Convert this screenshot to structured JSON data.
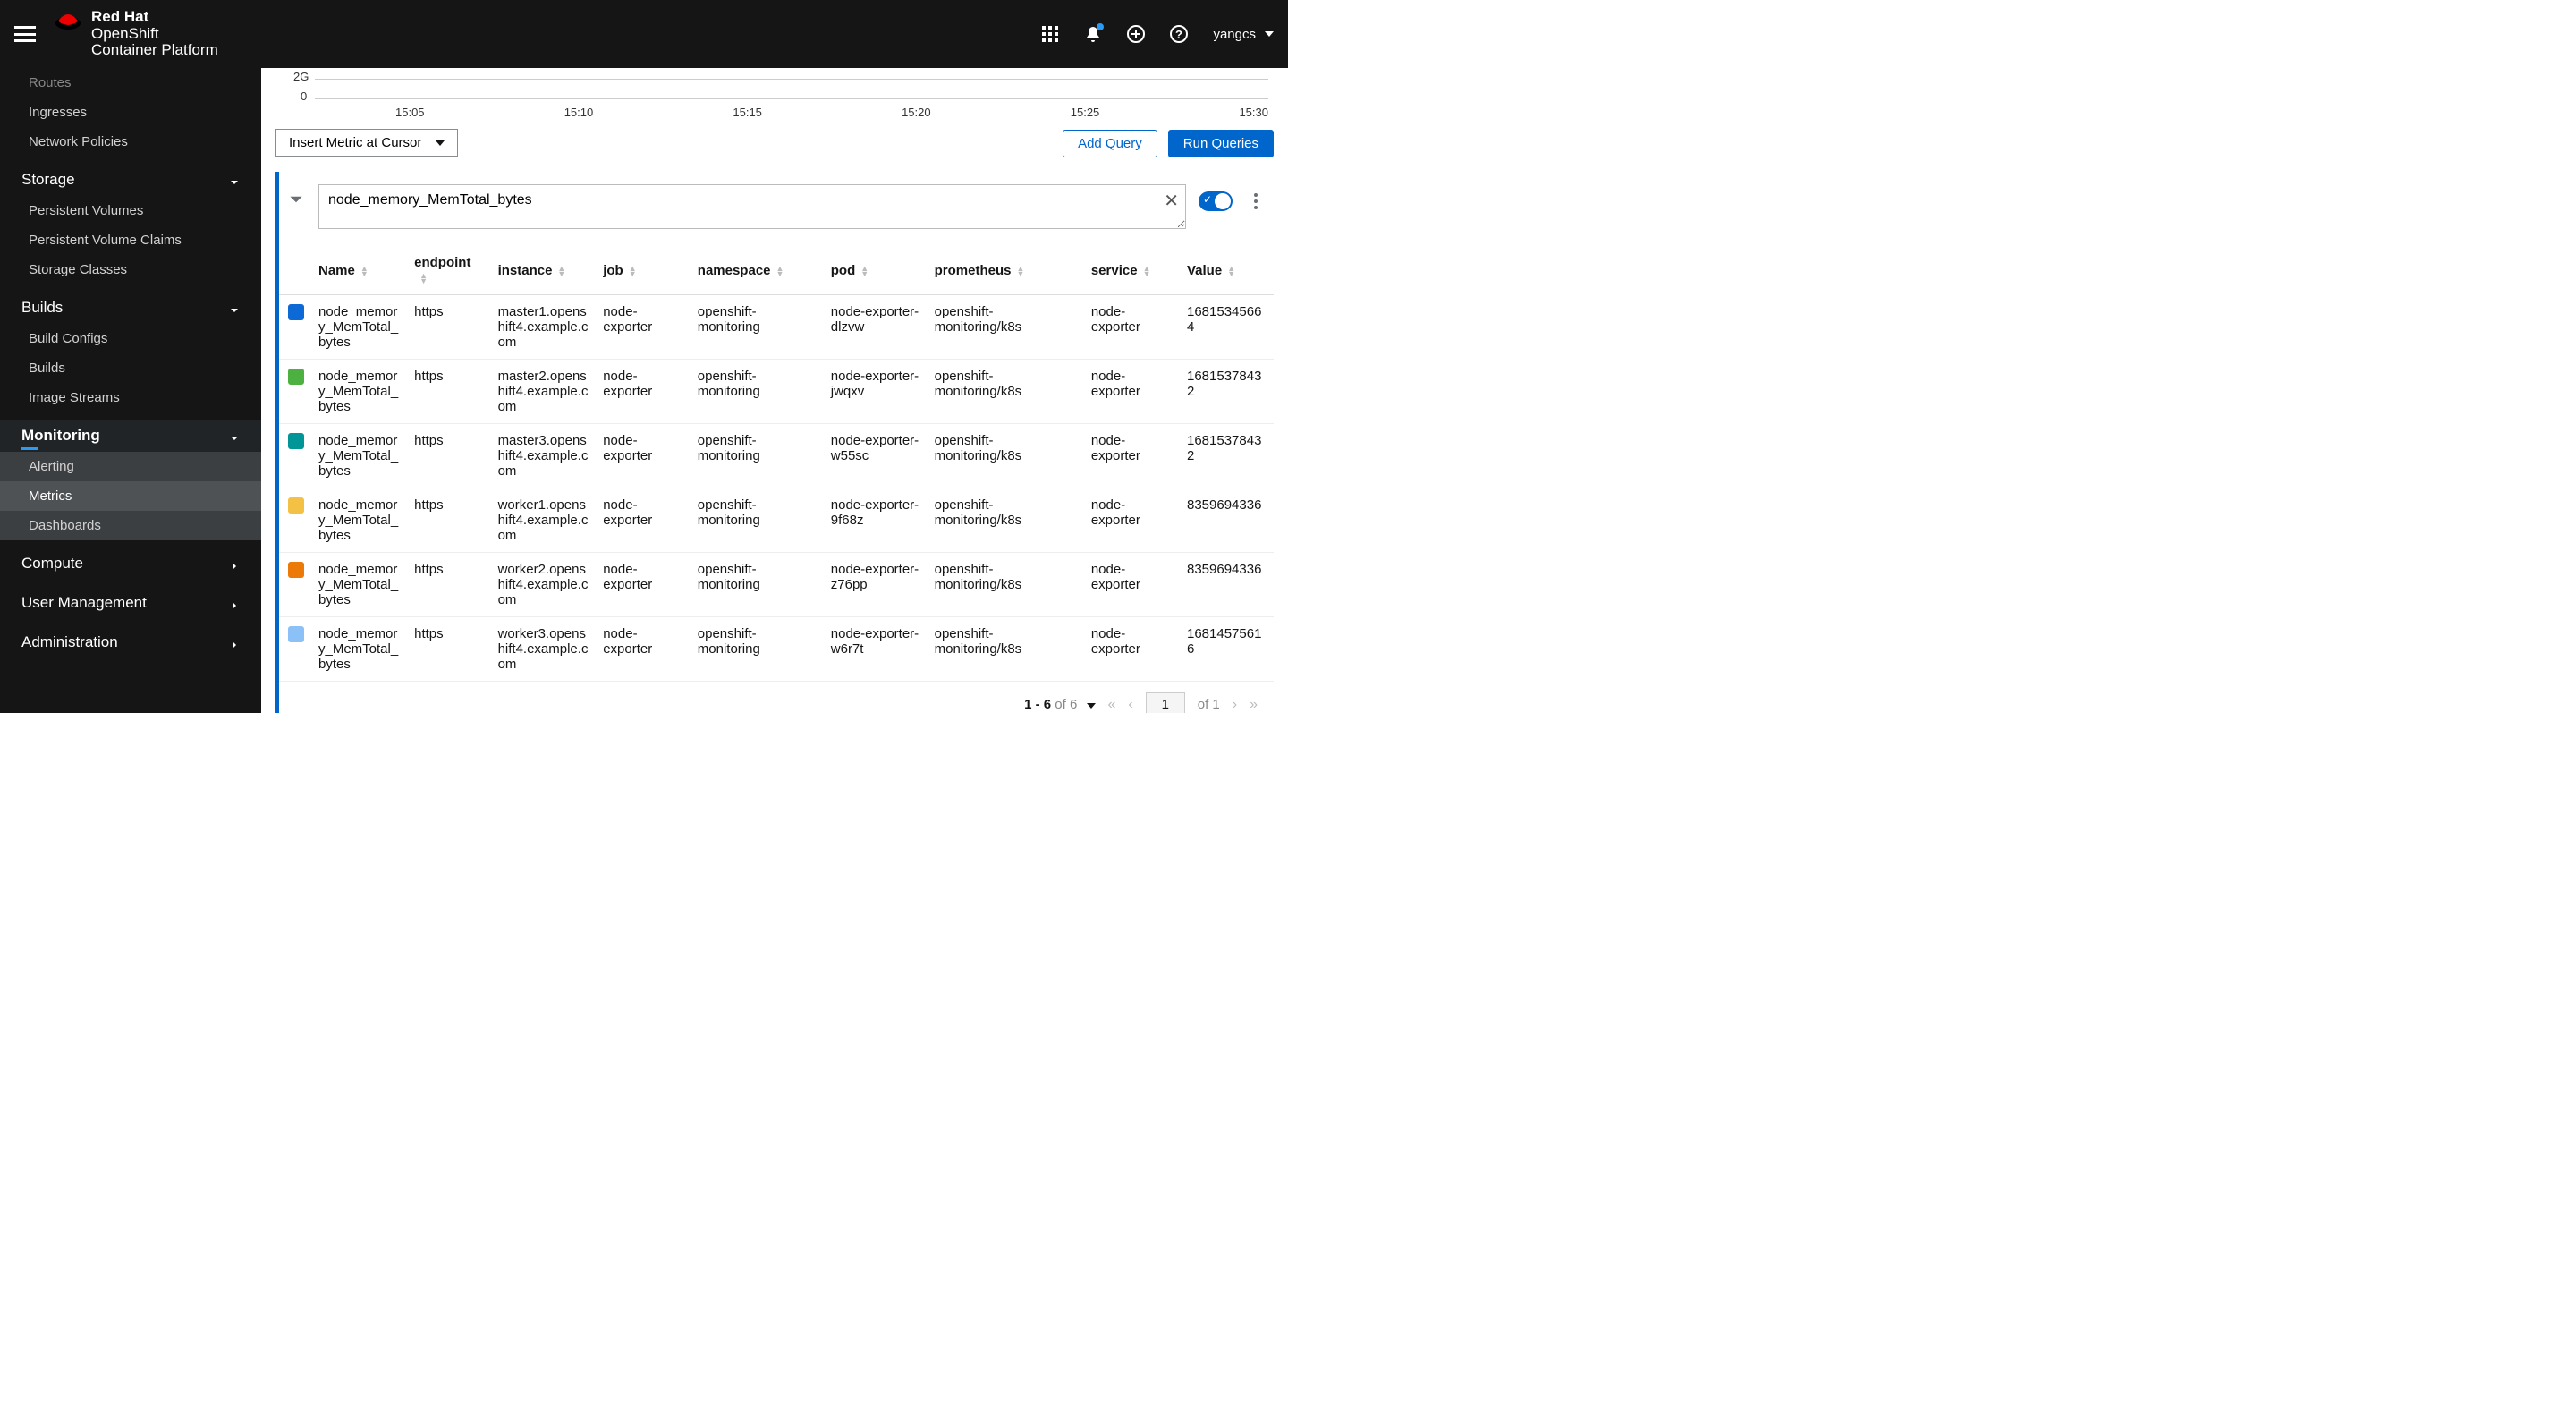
{
  "header": {
    "product_l1": "Red Hat",
    "product_l2": "OpenShift",
    "product_l3": "Container Platform",
    "username": "yangcs"
  },
  "sidebar": {
    "items_top": [
      "Routes",
      "Ingresses",
      "Network Policies"
    ],
    "storage": {
      "label": "Storage",
      "items": [
        "Persistent Volumes",
        "Persistent Volume Claims",
        "Storage Classes"
      ]
    },
    "builds": {
      "label": "Builds",
      "items": [
        "Build Configs",
        "Builds",
        "Image Streams"
      ]
    },
    "monitoring": {
      "label": "Monitoring",
      "items": [
        "Alerting",
        "Metrics",
        "Dashboards"
      ],
      "active": "Metrics"
    },
    "compute": {
      "label": "Compute"
    },
    "usermgmt": {
      "label": "User Management"
    },
    "admin": {
      "label": "Administration"
    }
  },
  "chart_data": {
    "type": "line",
    "ylabels": [
      "2G",
      "0"
    ],
    "xticks": [
      "15:05",
      "15:10",
      "15:15",
      "15:20",
      "15:25",
      "15:30"
    ]
  },
  "toolbar": {
    "dropdown_label": "Insert Metric at Cursor",
    "add_query": "Add Query",
    "run_queries": "Run Queries"
  },
  "query": {
    "value": "node_memory_MemTotal_bytes"
  },
  "table": {
    "headers": [
      "Name",
      "endpoint",
      "instance",
      "job",
      "namespace",
      "pod",
      "prometheus",
      "service",
      "Value"
    ],
    "rows": [
      {
        "color": "#0d69d6",
        "name": "node_memory_MemTotal_bytes",
        "endpoint": "https",
        "instance": "master1.openshift4.example.com",
        "job": "node-exporter",
        "namespace": "openshift-monitoring",
        "pod": "node-exporter-dlzvw",
        "prometheus": "openshift-monitoring/k8s",
        "service": "node-exporter",
        "value": "16815345664"
      },
      {
        "color": "#4cb140",
        "name": "node_memory_MemTotal_bytes",
        "endpoint": "https",
        "instance": "master2.openshift4.example.com",
        "job": "node-exporter",
        "namespace": "openshift-monitoring",
        "pod": "node-exporter-jwqxv",
        "prometheus": "openshift-monitoring/k8s",
        "service": "node-exporter",
        "value": "16815378432"
      },
      {
        "color": "#009596",
        "name": "node_memory_MemTotal_bytes",
        "endpoint": "https",
        "instance": "master3.openshift4.example.com",
        "job": "node-exporter",
        "namespace": "openshift-monitoring",
        "pod": "node-exporter-w55sc",
        "prometheus": "openshift-monitoring/k8s",
        "service": "node-exporter",
        "value": "16815378432"
      },
      {
        "color": "#f4c145",
        "name": "node_memory_MemTotal_bytes",
        "endpoint": "https",
        "instance": "worker1.openshift4.example.com",
        "job": "node-exporter",
        "namespace": "openshift-monitoring",
        "pod": "node-exporter-9f68z",
        "prometheus": "openshift-monitoring/k8s",
        "service": "node-exporter",
        "value": "8359694336"
      },
      {
        "color": "#ec7a08",
        "name": "node_memory_MemTotal_bytes",
        "endpoint": "https",
        "instance": "worker2.openshift4.example.com",
        "job": "node-exporter",
        "namespace": "openshift-monitoring",
        "pod": "node-exporter-z76pp",
        "prometheus": "openshift-monitoring/k8s",
        "service": "node-exporter",
        "value": "8359694336"
      },
      {
        "color": "#8bc1f7",
        "name": "node_memory_MemTotal_bytes",
        "endpoint": "https",
        "instance": "worker3.openshift4.example.com",
        "job": "node-exporter",
        "namespace": "openshift-monitoring",
        "pod": "node-exporter-w6r7t",
        "prometheus": "openshift-monitoring/k8s",
        "service": "node-exporter",
        "value": "16814575616"
      }
    ]
  },
  "pagination": {
    "range": "1 - 6",
    "of_label1": "of",
    "total_rows": "6",
    "page": "1",
    "of_label2": "of",
    "total_pages": "1"
  }
}
